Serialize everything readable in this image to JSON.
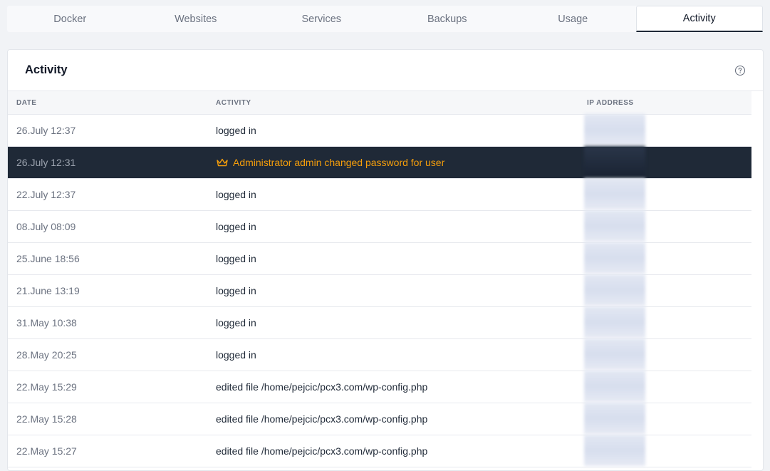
{
  "tabs": [
    {
      "label": "Docker",
      "active": false
    },
    {
      "label": "Websites",
      "active": false
    },
    {
      "label": "Services",
      "active": false
    },
    {
      "label": "Backups",
      "active": false
    },
    {
      "label": "Usage",
      "active": false
    },
    {
      "label": "Activity",
      "active": true
    }
  ],
  "card": {
    "title": "Activity",
    "help_icon": "question-circle-icon"
  },
  "table": {
    "headers": {
      "date": "DATE",
      "activity": "ACTIVITY",
      "ip": "IP ADDRESS"
    },
    "rows": [
      {
        "date": "26.July 12:37",
        "activity": "logged in",
        "ip": ""
      },
      {
        "date": "26.July 12:31",
        "activity": "Administrator admin changed password for user",
        "ip": "",
        "icon": "crown-icon"
      },
      {
        "date": "22.July 12:37",
        "activity": "logged in",
        "ip": ""
      },
      {
        "date": "08.July 08:09",
        "activity": "logged in",
        "ip": ""
      },
      {
        "date": "25.June 18:56",
        "activity": "logged in",
        "ip": ""
      },
      {
        "date": "21.June 13:19",
        "activity": "logged in",
        "ip": ""
      },
      {
        "date": "31.May 10:38",
        "activity": "logged in",
        "ip": ""
      },
      {
        "date": "28.May 20:25",
        "activity": "logged in",
        "ip": ""
      },
      {
        "date": "22.May 15:29",
        "activity": "edited file /home/pejcic/pcx3.com/wp-config.php",
        "ip": ""
      },
      {
        "date": "22.May 15:28",
        "activity": "edited file /home/pejcic/pcx3.com/wp-config.php",
        "ip": ""
      },
      {
        "date": "22.May 15:27",
        "activity": "edited file /home/pejcic/pcx3.com/wp-config.php",
        "ip": ""
      }
    ]
  },
  "colors": {
    "highlight_bg": "#1f2937",
    "highlight_text": "#f59e0b"
  }
}
